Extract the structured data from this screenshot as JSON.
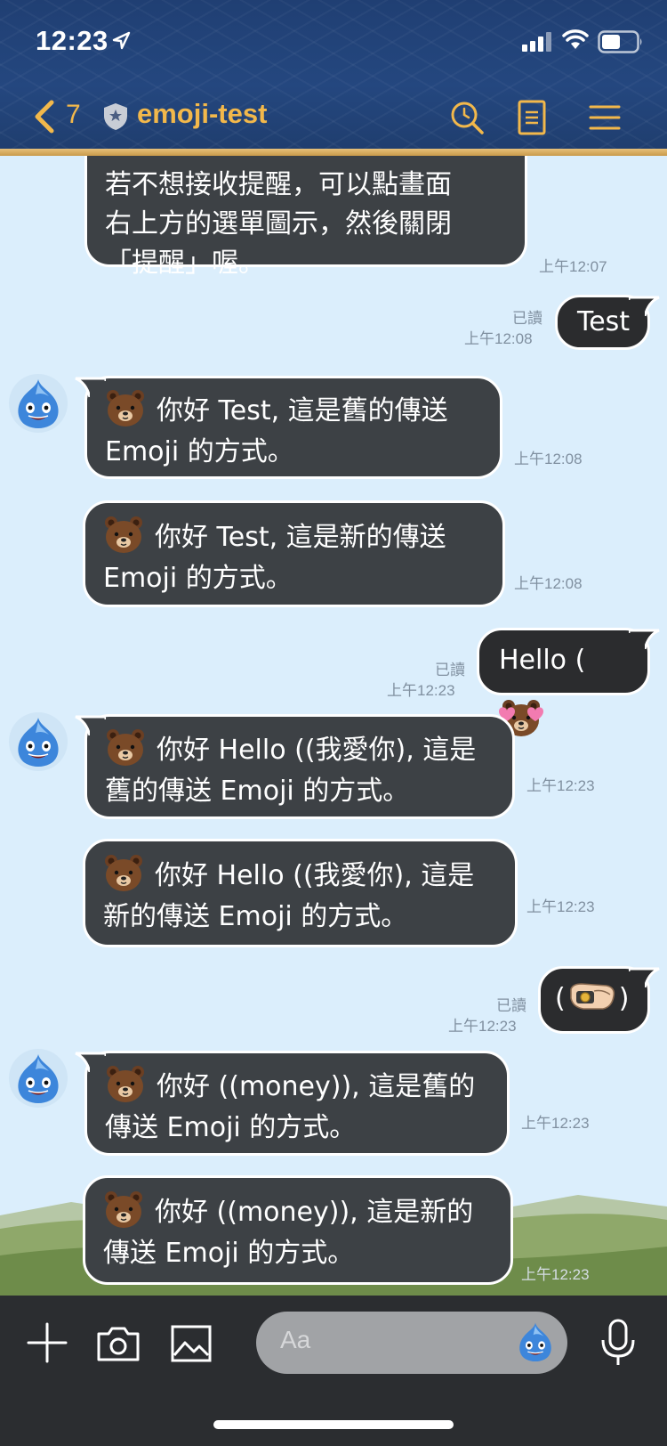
{
  "status_bar": {
    "time": "12:23",
    "icons": [
      "location-arrow-icon",
      "signal-icon",
      "wifi-icon",
      "battery-icon"
    ]
  },
  "header": {
    "back_count": "7",
    "title": "emoji-test",
    "colors": {
      "accent": "#f2b84b",
      "background": "#22437a"
    }
  },
  "messages": [
    {
      "side": "in",
      "text": "若不想接收提醒，可以點畫面\n右上方的選單圖示，然後關閉\n「提醒」喔。",
      "time": "上午12:07"
    },
    {
      "side": "out",
      "text": "Test",
      "read": "已讀",
      "time": "上午12:08"
    },
    {
      "side": "in",
      "emoji": "brown-bear-emoji",
      "line1": "你好 Test, 這是舊的傳送",
      "line2": "Emoji 的方式。",
      "time": "上午12:08"
    },
    {
      "side": "in",
      "emoji": "brown-bear-emoji",
      "line1": "你好 Test, 這是新的傳送",
      "line2": "Emoji 的方式。",
      "time": "上午12:08"
    },
    {
      "side": "out",
      "text": "Hello (",
      "emoji": "brown-bear-love-emoji",
      "read": "已讀",
      "time": "上午12:23"
    },
    {
      "side": "in",
      "emoji": "brown-bear-emoji",
      "line1": "你好 Hello ((我愛你), 這是",
      "line2": "舊的傳送 Emoji 的方式。",
      "time": "上午12:23"
    },
    {
      "side": "in",
      "emoji": "brown-bear-emoji",
      "line1": "你好 Hello ((我愛你), 這是",
      "line2": "新的傳送 Emoji 的方式。",
      "time": "上午12:23"
    },
    {
      "side": "out",
      "text_left": "(",
      "emoji": "money-hand-emoji",
      "text_right": ")",
      "read": "已讀",
      "time": "上午12:23"
    },
    {
      "side": "in",
      "emoji": "brown-bear-emoji",
      "line1": "你好 ((money)), 這是舊的",
      "line2": "傳送 Emoji 的方式。",
      "time": "上午12:23"
    },
    {
      "side": "in",
      "emoji": "brown-bear-emoji",
      "line1": "你好 ((money)), 這是新的",
      "line2": "傳送 Emoji 的方式。",
      "time": "上午12:23"
    }
  ],
  "input_bar": {
    "placeholder": "Aa",
    "icons": [
      "plus-icon",
      "camera-icon",
      "image-icon",
      "slime-sticker-icon",
      "microphone-icon"
    ]
  }
}
